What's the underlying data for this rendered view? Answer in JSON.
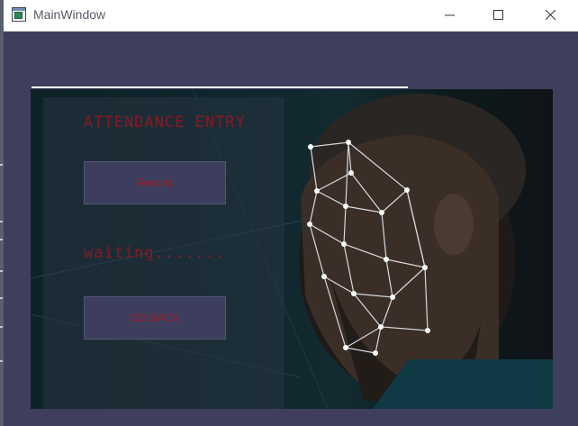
{
  "window": {
    "title": "MainWindow"
  },
  "form": {
    "heading": "ATTENDANCE ENTRY",
    "record_label": "Record",
    "status_text": "waiting.......",
    "go_back_label": "GO BACK"
  },
  "colors": {
    "window_background": "#3f3e5c",
    "button_background": "#3d3e5d",
    "text_red": "#a6161e"
  },
  "icons": {
    "app": "window-app-icon",
    "minimize": "minimize-icon",
    "maximize": "maximize-icon",
    "close": "close-icon"
  }
}
